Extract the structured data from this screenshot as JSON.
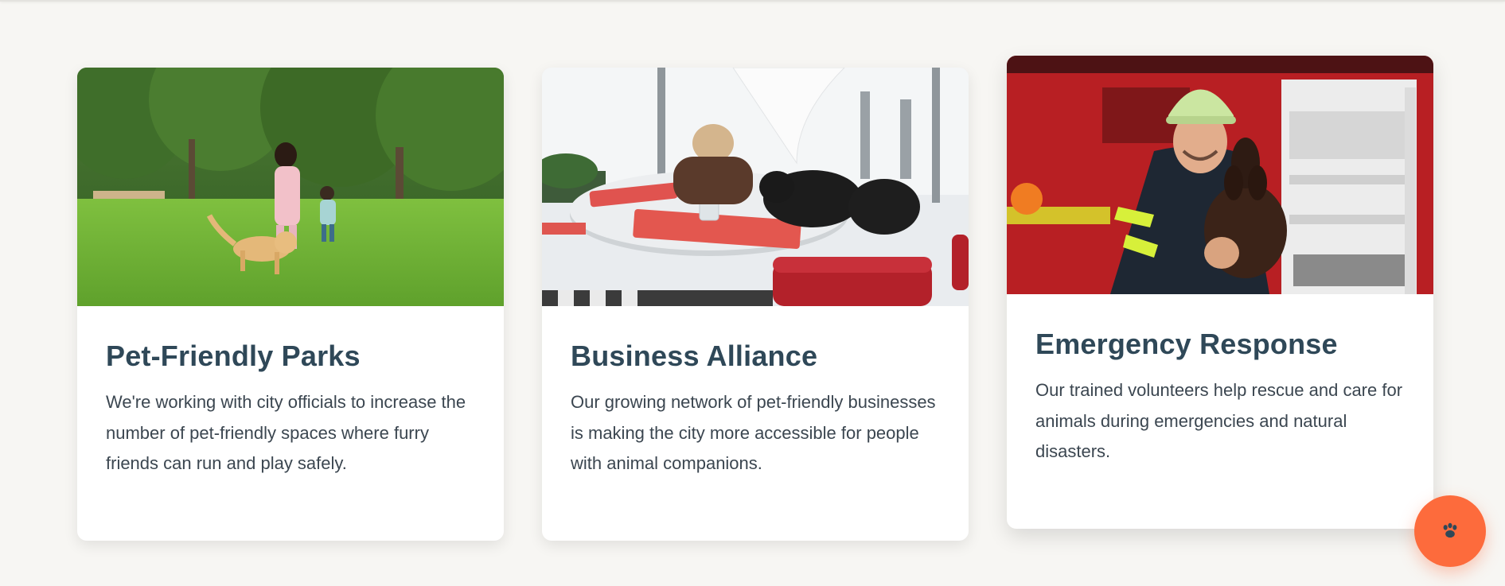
{
  "cards": [
    {
      "title": "Pet-Friendly Parks",
      "text": "We're working with city officials to increase the number of pet-friendly spaces where furry friends can run and play safely.",
      "image": "park-with-family-and-dog-photo"
    },
    {
      "title": "Business Alliance",
      "text": "Our growing network of pet-friendly businesses is making the city more accessible for people with animal companions.",
      "image": "cafe-with-woman-and-dogs-photo"
    },
    {
      "title": "Emergency Response",
      "text": "Our trained volunteers help rescue and care for animals during emergencies and natural disasters.",
      "image": "firefighter-holding-dog-photo"
    }
  ],
  "fab": {
    "icon": "paw-icon",
    "color": "#fd6b3c"
  },
  "colors": {
    "page_background": "#f7f6f3",
    "title": "#2f4858",
    "text": "#3b4650"
  }
}
